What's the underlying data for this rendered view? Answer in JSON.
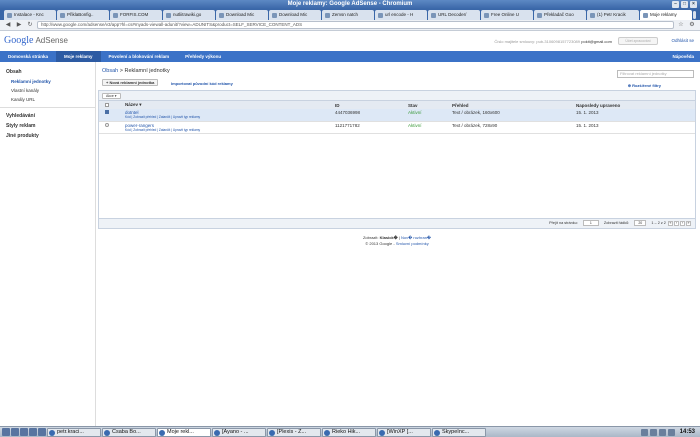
{
  "window": {
    "title": "Moje reklamy: Google AdSense - Chromium"
  },
  "tabs": [
    {
      "label": "Instalace - Knc"
    },
    {
      "label": "PřiklaBonfig.."
    },
    {
      "label": "FORFIS.COM"
    },
    {
      "label": "nutliitrawiki.go"
    },
    {
      "label": "Download Mic"
    },
    {
      "label": "Download Mic"
    },
    {
      "label": "Zemsn natch"
    },
    {
      "label": "url encode - H"
    },
    {
      "label": "URL Decoder/"
    },
    {
      "label": "Free Online U"
    },
    {
      "label": "Překladač Goo"
    },
    {
      "label": "(1) Petr Kracik"
    },
    {
      "label": "Moje reklamy"
    }
  ],
  "browser": {
    "url": "http://www.google.com/adsense/v3/app?hl=cs#myads-viewall-adunit/?view=ADUNITS&product=SELF_SERVICE_CONTENT_ADS"
  },
  "header": {
    "logo_google": "Google",
    "logo_product": "AdSense",
    "info": "Číslo majitele smlouvy: pub-3106098157723089",
    "email": "pokit@gmail.com",
    "settings_button": "Účet zpracování",
    "logout": "Odhlásit se"
  },
  "nav": {
    "items": [
      {
        "label": "Domovská stránka"
      },
      {
        "label": "Moje reklamy"
      },
      {
        "label": "Povolení a blokování reklam"
      },
      {
        "label": "Přehledy výkonu"
      }
    ],
    "help": "Nápověda"
  },
  "sidebar": {
    "section_content": "Obsah",
    "items": [
      {
        "label": "Reklamní jednotky"
      },
      {
        "label": "Vlastní kanály"
      },
      {
        "label": "Kanály URL"
      }
    ],
    "section_search": "Vyhledávání",
    "section_styles": "Styly reklam",
    "section_other": "Jiné produkty"
  },
  "main": {
    "breadcrumb_root": "Obsah",
    "breadcrumb_sep": " > ",
    "breadcrumb_current": "Reklamní jednotky",
    "new_button": "+ Nová reklamní jednotka",
    "import_link": "Importovat původní kód reklamy",
    "filter_placeholder": "Filtrovat reklamní jednotky",
    "advanced_filter": "Rozšířené filtry",
    "actions_label": "Akce",
    "columns": [
      "Název",
      "ID",
      "Stav",
      "Přehled",
      "Naposledy upraveno"
    ],
    "rows": [
      {
        "name": "dotntel",
        "links": "Kód | Zobrazit přehled | Zatančit | Upravit typ reklamy",
        "id": "4447036998",
        "status": "Aktivní",
        "overview": "Text / obrázek, 160x600",
        "modified": "15. 1. 2013"
      },
      {
        "name": "power-rangers",
        "links": "Kód | Zobrazit přehled | Zatančit | Upravit typ reklamy",
        "id": "1121771782",
        "status": "Aktivní",
        "overview": "Text / obrázek, 728x90",
        "modified": "15. 1. 2013"
      }
    ],
    "pager": {
      "go_to_page": "Přejít na stránku:",
      "page_value": "1",
      "show_rows": "Zobrazit řádků:",
      "rows_value": "20",
      "range": "1 – 2 z 2"
    },
    "footer": {
      "switch_prefix": "Zobrazit: ",
      "switch_classic": "Klasick�",
      "switch_sep": " | ",
      "switch_new": "Nov� rozhran�",
      "copyright": "© 2013 Google - ",
      "terms": "Smluvní podmínky"
    }
  },
  "taskbar": {
    "items": [
      {
        "label": "petr.kraci..."
      },
      {
        "label": "Csaba Bo..."
      },
      {
        "label": "Moje rekl..."
      },
      {
        "label": "[Ayano - ..."
      },
      {
        "label": "[Plexis - Z..."
      },
      {
        "label": "Rieko Hik..."
      },
      {
        "label": "[WinXP [..."
      },
      {
        "label": "SkypeInc..."
      }
    ],
    "clock": "14:53"
  }
}
